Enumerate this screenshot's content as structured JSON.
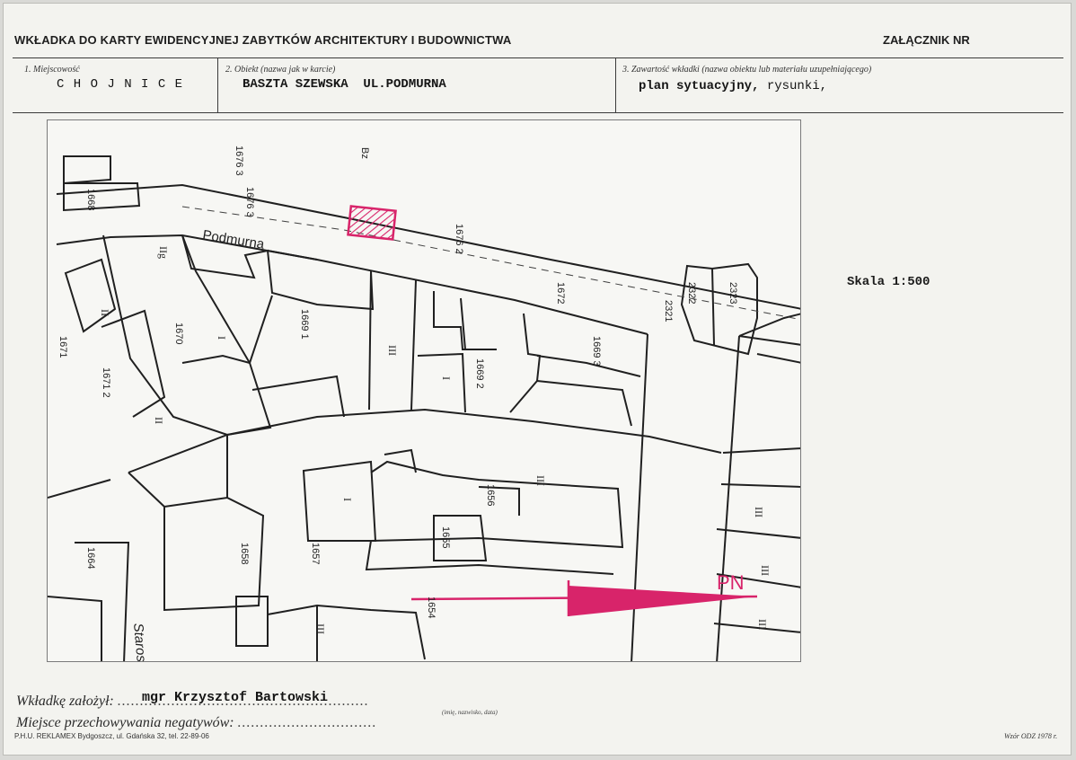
{
  "header": {
    "title": "WKŁADKA DO KARTY EWIDENCYJNEJ ZABYTKÓW ARCHITEKTURY I BUDOWNICTWA",
    "annex": "ZAŁĄCZNIK NR"
  },
  "fields": {
    "locality": {
      "label": "1. Miejscowość",
      "value": "CHOJNICE",
      "value_display": "C H O J N I C E"
    },
    "object": {
      "label": "2. Obiekt (nazwa jak w karcie)",
      "value": "BASZTA SZEWSKA  UL.PODMURNA"
    },
    "contents": {
      "label": "3. Zawartość wkładki (nazwa obiektu lub materiału uzupełniającego)",
      "value_bold": "plan sytuacyjny,",
      "value_rest": " rysunki,"
    }
  },
  "scale_text": "Skala 1:500",
  "map": {
    "street_labels": [
      "Podmurna",
      "Staroszkolna"
    ],
    "parcel_labels": [
      "1676 3",
      "1676 3",
      "1676 2",
      "1668",
      "1672",
      "2321",
      "2322",
      "2323",
      "1669 1",
      "1670",
      "1671",
      "1671 2",
      "1669 3",
      "1669 2",
      "1656",
      "1655",
      "1654",
      "1664",
      "1658",
      "1657",
      "Bz"
    ],
    "floor_marks": [
      "II",
      "III",
      "IIg",
      "II",
      "I",
      "III",
      "III",
      "I",
      "I",
      "III",
      "III",
      "III"
    ],
    "north_label": "PN",
    "accent_color": "#d8246a"
  },
  "footer": {
    "founder_label": "Wkładkę założył:",
    "founder_dots": "........................................................",
    "founder_value": "mgr Krzysztof Bartowski",
    "founder_hint": "(imię, nazwisko, data)",
    "negatives_label": "Miejsce przechowywania negatywów:",
    "negatives_dots": "...............................",
    "printer": "P.H.U. REKLAMEX Bydgoszcz, ul. Gdańska 32, tel. 22-89-06",
    "model": "Wzór ODZ 1978 r."
  }
}
